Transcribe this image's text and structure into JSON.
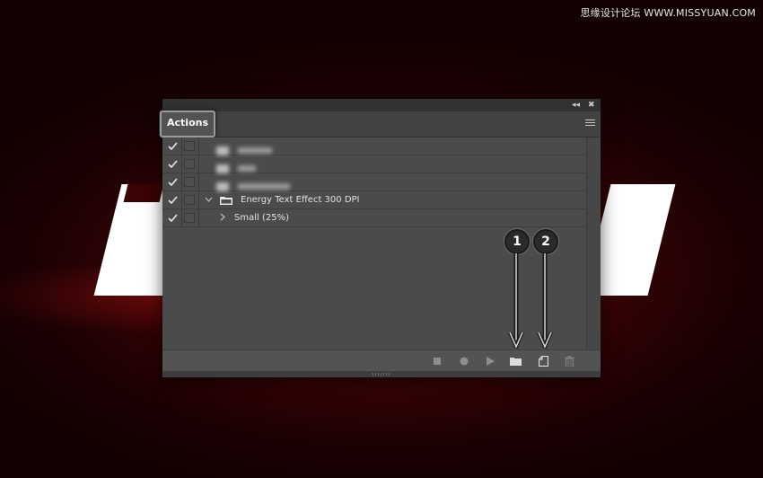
{
  "watermark": "思缘设计论坛 WWW.MISSYUAN.COM",
  "panel": {
    "tab_label": "Actions",
    "collapse_glyph": "◂◂",
    "close_glyph": "✖",
    "rows": [
      {
        "checked": true,
        "blurred": true
      },
      {
        "checked": true,
        "blurred": true
      },
      {
        "checked": true,
        "blurred": true
      },
      {
        "checked": true,
        "blurred": false,
        "label": "Energy Text Effect 300 DPI",
        "expanded": true,
        "type": "set"
      },
      {
        "checked": true,
        "blurred": false,
        "label": "Small (25%)",
        "expanded": false,
        "type": "action"
      }
    ]
  },
  "bottom_buttons": [
    "stop-icon",
    "record-icon",
    "play-icon",
    "new-set-folder-icon",
    "new-action-icon",
    "trash-icon"
  ],
  "annotations": [
    {
      "number": "1",
      "target": "new-set-folder-icon"
    },
    {
      "number": "2",
      "target": "new-action-icon"
    }
  ],
  "colors": {
    "panel_bg": "#535353",
    "list_bg": "#4b4b4b",
    "topbar_bg": "#323232",
    "background_red": "#3a0305"
  }
}
